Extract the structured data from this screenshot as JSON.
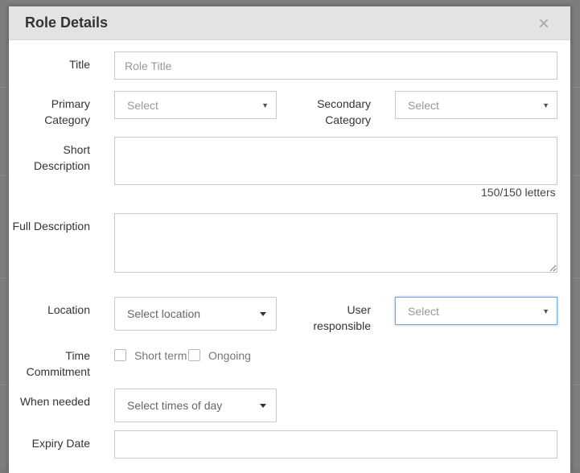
{
  "modal": {
    "title": "Role Details",
    "close_glyph": "×"
  },
  "form": {
    "title": {
      "label": "Title",
      "placeholder": "Role Title"
    },
    "primary_category": {
      "label": "Primary Category",
      "value": "Select"
    },
    "secondary_category": {
      "label": "Secondary Category",
      "value": "Select"
    },
    "short_description": {
      "label": "Short Description",
      "counter": "150/150 letters"
    },
    "full_description": {
      "label": "Full Description"
    },
    "location": {
      "label": "Location",
      "value": "Select location"
    },
    "user_responsible": {
      "label": "User responsible",
      "value": "Select"
    },
    "time_commitment": {
      "label": "Time Commitment",
      "options": [
        {
          "label": "Short term",
          "checked": false
        },
        {
          "label": "Ongoing",
          "checked": false
        }
      ]
    },
    "when_needed": {
      "label": "When needed",
      "value": "Select times of day"
    },
    "expiry_date": {
      "label": "Expiry Date"
    }
  },
  "icons": {
    "select_arrow": "▼",
    "close": "close-icon"
  },
  "colors": {
    "header_bg": "#e3e3e3",
    "focus_border": "#7aa7d9",
    "overlay": "#7e7e7e"
  }
}
